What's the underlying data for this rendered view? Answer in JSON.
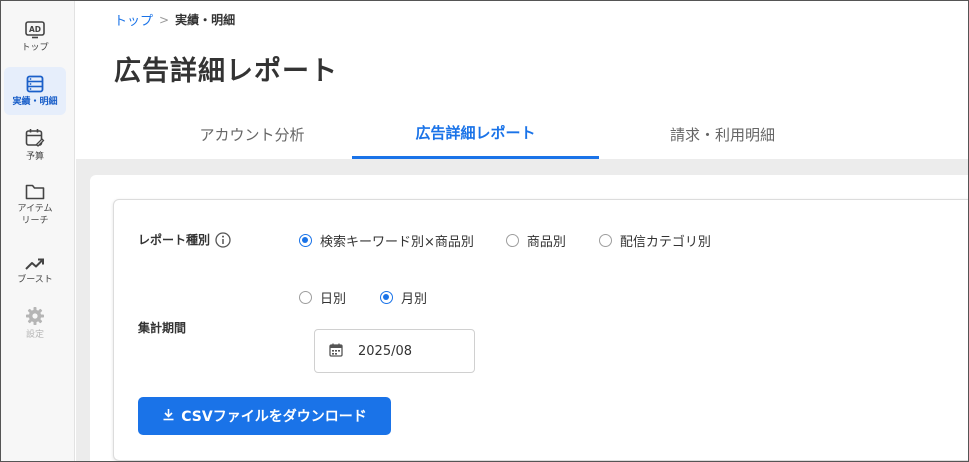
{
  "sidebar": {
    "items": [
      {
        "label": "トップ",
        "icon": "ad-icon"
      },
      {
        "label": "実績・明細",
        "icon": "report-list-icon",
        "active": true
      },
      {
        "label": "予算",
        "icon": "budget-calendar-icon"
      },
      {
        "label": "アイテム\nリーチ",
        "icon": "folder-icon"
      },
      {
        "label": "ブースト",
        "icon": "trending-up-icon"
      },
      {
        "label": "設定",
        "icon": "gear-icon",
        "disabled": true
      }
    ]
  },
  "breadcrumb": {
    "home": "トップ",
    "separator": ">",
    "current": "実績・明細"
  },
  "page_title": "広告詳細レポート",
  "tabs": [
    {
      "label": "アカウント分析"
    },
    {
      "label": "広告詳細レポート",
      "active": true
    },
    {
      "label": "請求・利用明細"
    }
  ],
  "form": {
    "report_type": {
      "label": "レポート種別",
      "options": [
        {
          "label": "検索キーワード別×商品別",
          "checked": true
        },
        {
          "label": "商品別",
          "checked": false
        },
        {
          "label": "配信カテゴリ別",
          "checked": false
        }
      ]
    },
    "period": {
      "label": "集計期間",
      "options": [
        {
          "label": "日別",
          "checked": false
        },
        {
          "label": "月別",
          "checked": true
        }
      ],
      "date_value": "2025/08"
    },
    "download_button": "CSVファイルをダウンロード"
  },
  "colors": {
    "accent": "#1a73e8",
    "active_nav_bg": "#e6eefb",
    "content_bg": "#ececec"
  }
}
